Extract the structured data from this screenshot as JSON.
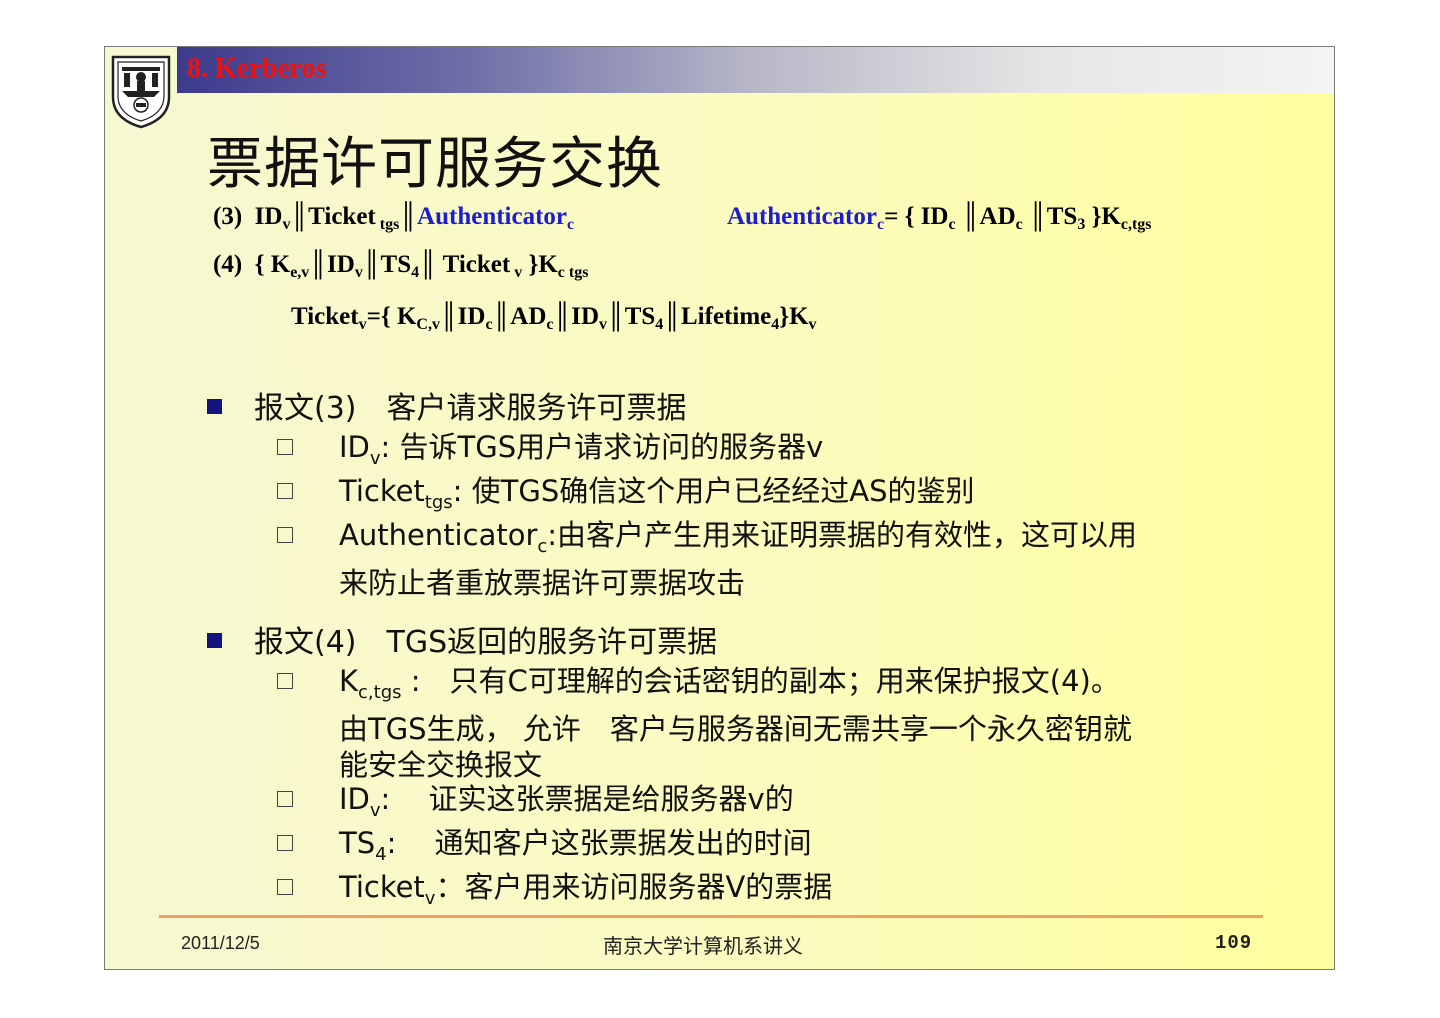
{
  "header": {
    "section_title": "8.   Kerberos"
  },
  "slide_title": "票据许可服务交换",
  "formulas": {
    "m3_label": "(3)",
    "m3_text": "IDv║Ticket tgs║",
    "m3_auth": "Authenticatorc",
    "m3_auth_def_name": "Authenticatorc",
    "m3_auth_def_rest": "= { IDc ║ADc ║TS3 }Kc,tgs",
    "m4_label": "(4)",
    "m4_text": "{ Ke,v║IDv║TS4║ Ticket v }Kc tgs",
    "ticket_def": "Ticketv={ KC,v║IDc║ADc║IDv║TS4║Lifetime4}Kv"
  },
  "bullets": [
    {
      "label": "报文(3)　客户请求服务许可票据",
      "items": [
        "IDv: 告诉TGS用户请求访问的服务器v",
        "Tickettgs: 使TGS确信这个用户已经经过AS的鉴别",
        "Authenticatorc:由客户产生用来证明票据的有效性，这可以用 来防止者重放票据许可票据攻击"
      ]
    },
    {
      "label": "报文(4)　TGS返回的服务许可票据",
      "items": [
        "Kc,tgs :　只有C可理解的会话密钥的副本；用来保护报文(4)。 由TGS生成， 允许　客户与服务器间无需共享一个永久密钥就 能安全交换报文",
        "IDv:　证实这张票据是给服务器v的",
        "TS4:　通知客户这张票据发出的时间",
        "Ticketv：客户用来访问服务器V的票据"
      ]
    }
  ],
  "footer": {
    "date": "2011/12/5",
    "center": "南京大学计算机系讲义",
    "page": "109"
  },
  "colors": {
    "header_title": "#ee1111",
    "highlight_blue": "#1c1cd0",
    "bullet_marker": "#141480",
    "footer_line": "#f4a060"
  },
  "icons": {
    "logo": "nanjing-university-seal",
    "bullet": "filled-square",
    "sub_bullet": "hollow-square"
  }
}
